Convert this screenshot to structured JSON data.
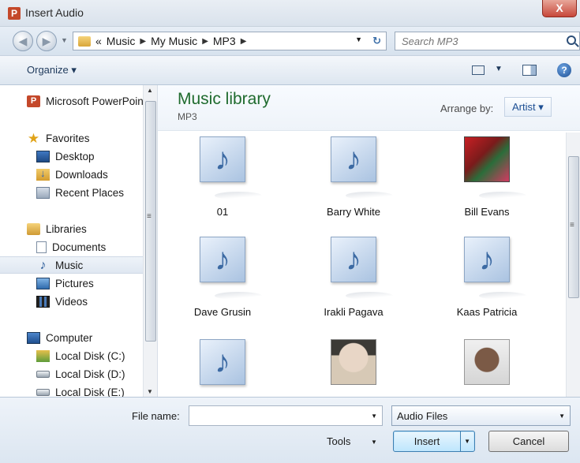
{
  "window": {
    "title": "Insert Audio",
    "close_label": "X",
    "app_icon": "P"
  },
  "address": {
    "crumb_prefix": "«",
    "crumbs": [
      "Music",
      "My Music",
      "MP3"
    ],
    "search_placeholder": "Search MP3"
  },
  "toolbar": {
    "organize_label": "Organize ▾",
    "help_label": "?"
  },
  "nav": {
    "items": [
      {
        "label": "Microsoft PowerPoint",
        "icon": "powerpoint-icon"
      },
      {
        "label": "Favorites",
        "icon": "star-icon"
      },
      {
        "label": "Desktop",
        "icon": "desktop-icon"
      },
      {
        "label": "Downloads",
        "icon": "downloads-icon"
      },
      {
        "label": "Recent Places",
        "icon": "recent-places-icon"
      },
      {
        "label": "Libraries",
        "icon": "libraries-icon"
      },
      {
        "label": "Documents",
        "icon": "documents-icon"
      },
      {
        "label": "Music",
        "icon": "music-note-icon"
      },
      {
        "label": "Pictures",
        "icon": "pictures-icon"
      },
      {
        "label": "Videos",
        "icon": "videos-icon"
      },
      {
        "label": "Computer",
        "icon": "computer-icon"
      },
      {
        "label": "Local Disk (C:)",
        "icon": "local-disk-c-icon"
      },
      {
        "label": "Local Disk (D:)",
        "icon": "local-disk-icon"
      },
      {
        "label": "Local Disk (E:)",
        "icon": "local-disk-icon"
      }
    ],
    "selected": "Music"
  },
  "library": {
    "title": "Music library",
    "subtitle": "MP3",
    "arrange_label": "Arrange by:",
    "arrange_value": "Artist ▾"
  },
  "files": [
    {
      "label": "01",
      "thumb": "music-note"
    },
    {
      "label": "Barry White",
      "thumb": "music-note"
    },
    {
      "label": "Bill Evans",
      "thumb": "album-art"
    },
    {
      "label": "Dave Grusin",
      "thumb": "music-note"
    },
    {
      "label": "Irakli Pagava",
      "thumb": "music-note"
    },
    {
      "label": "Kaas Patricia",
      "thumb": "music-note"
    },
    {
      "label": "",
      "thumb": "music-note"
    },
    {
      "label": "",
      "thumb": "album-art"
    },
    {
      "label": "",
      "thumb": "album-art"
    }
  ],
  "footer": {
    "file_name_label": "File name:",
    "file_name_value": "",
    "file_type": "Audio Files",
    "tools_label": "Tools",
    "insert_label": "Insert",
    "cancel_label": "Cancel"
  },
  "colors": {
    "library_title": "#1f6b2e",
    "link_blue": "#1d4f93",
    "close_red": "#c7473a"
  }
}
